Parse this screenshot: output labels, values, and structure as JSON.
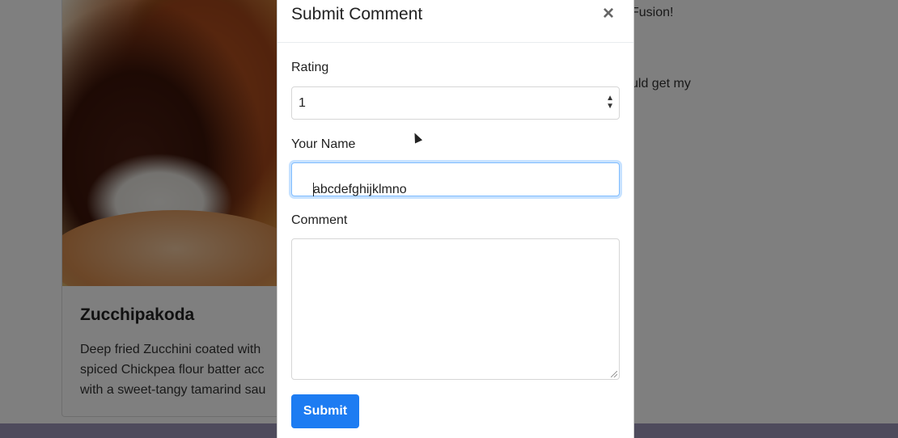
{
  "background": {
    "card": {
      "title": "Zucchipakoda",
      "description_lines": [
        "Deep fried Zucchini coated with",
        "spiced Chickpea flour batter acc",
        "with a sweet-tangy tamarind sau"
      ]
    },
    "right_fragments": [
      "Fusion!",
      "uld get my"
    ]
  },
  "modal": {
    "title": "Submit Comment",
    "close_symbol": "×",
    "rating": {
      "label": "Rating",
      "selected": "1"
    },
    "name": {
      "label": "Your Name",
      "value": "abcdefghijklmno"
    },
    "comment": {
      "label": "Comment",
      "value": ""
    },
    "submit_label": "Submit"
  },
  "colors": {
    "primary": "#1d7cf2",
    "focus_border": "#80bdff",
    "backdrop": "rgba(0,0,0,0.5)"
  },
  "icons": [
    "close-icon",
    "select-arrows-icon",
    "resize-grip-icon"
  ]
}
